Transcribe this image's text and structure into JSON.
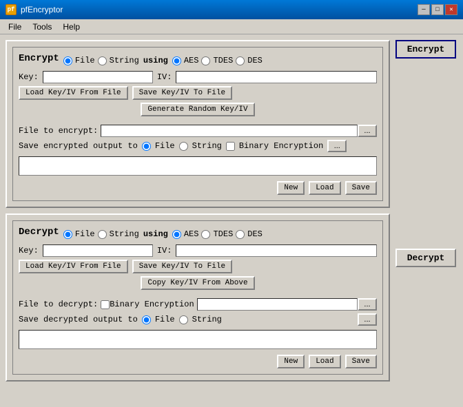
{
  "window": {
    "title": "pfEncryptor",
    "icon": "pf",
    "min_btn": "─",
    "max_btn": "□",
    "close_btn": "✕"
  },
  "menu": {
    "items": [
      "File",
      "Tools",
      "Help"
    ]
  },
  "encrypt_panel": {
    "title": "Encrypt",
    "file_radio": "File",
    "string_radio": "String",
    "using_label": "using",
    "aes_radio": "AES",
    "tdes_radio": "TDES",
    "des_radio": "DES",
    "key_label": "Key:",
    "iv_label": "IV:",
    "load_key_btn": "Load Key/IV From File",
    "save_key_btn": "Save Key/IV To File",
    "gen_key_btn": "Generate Random Key/IV",
    "file_to_encrypt_label": "File to encrypt:",
    "browse_btn": "...",
    "save_output_label": "Save encrypted output to",
    "save_file_radio": "File",
    "save_string_radio": "String",
    "binary_encryption_cb": "Binary Encryption",
    "save_browse_btn": "...",
    "new_btn": "New",
    "load_btn": "Load",
    "save_btn": "Save"
  },
  "decrypt_panel": {
    "title": "Decrypt",
    "file_radio": "File",
    "string_radio": "String",
    "using_label": "using",
    "aes_radio": "AES",
    "tdes_radio": "TDES",
    "des_radio": "DES",
    "key_label": "Key:",
    "iv_label": "IV:",
    "load_key_btn": "Load Key/IV From File",
    "save_key_btn": "Save Key/IV To File",
    "copy_key_btn": "Copy Key/IV From Above",
    "file_to_decrypt_label": "File to decrypt:",
    "binary_encryption_cb": "Binary Encryption",
    "browse_btn": "...",
    "save_output_label": "Save decrypted output to",
    "save_file_radio": "File",
    "save_string_radio": "String",
    "save_browse_btn": "...",
    "new_btn": "New",
    "load_btn": "Load",
    "save_btn": "Save"
  },
  "side_buttons": {
    "encrypt_btn": "Encrypt",
    "decrypt_btn": "Decrypt"
  }
}
